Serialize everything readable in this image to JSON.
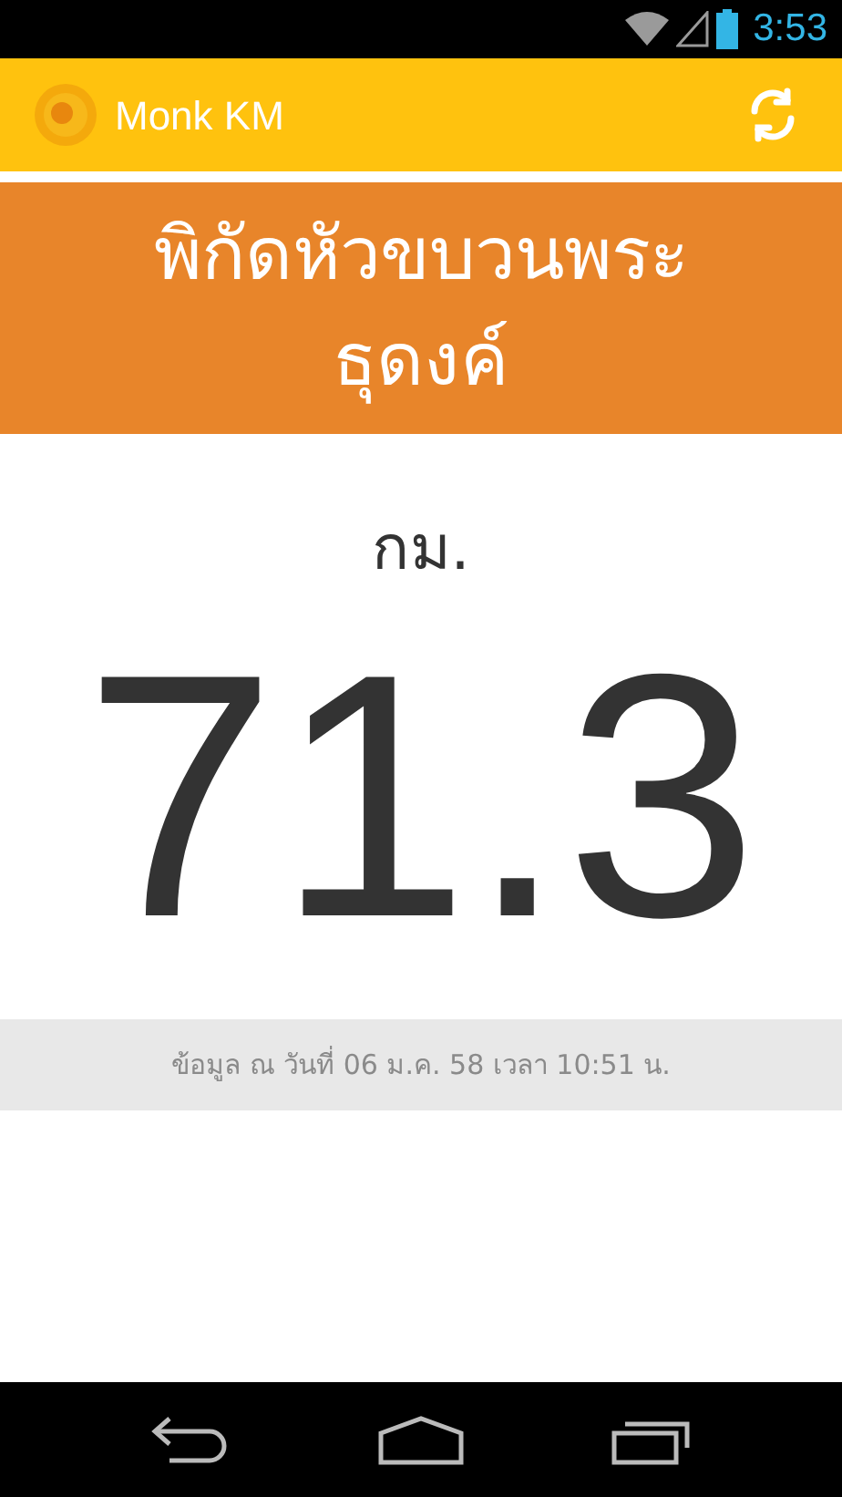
{
  "status_bar": {
    "time": "3:53"
  },
  "app_bar": {
    "title": "Monk KM"
  },
  "header": {
    "title": "พิกัดหัวขบวนพระธุดงค์"
  },
  "distance": {
    "unit": "กม.",
    "value": "71.3"
  },
  "updated": "ข้อมูล ณ วันที่ 06 ม.ค. 58 เวลา 10:51 น."
}
